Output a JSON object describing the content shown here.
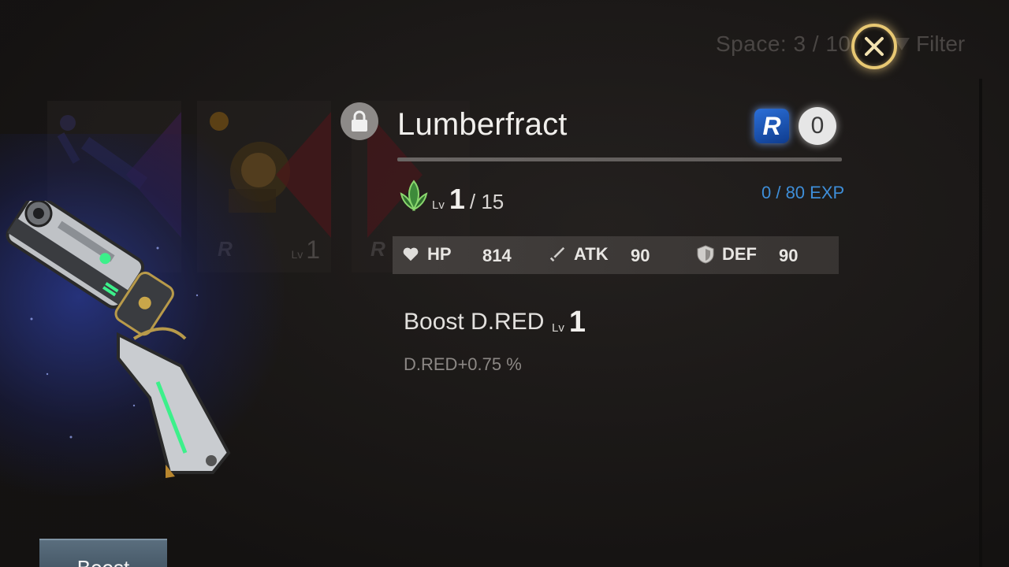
{
  "inventory": {
    "space_label": "Space: 3 / 100",
    "filter_label": "Filter"
  },
  "background_cards": [
    {
      "rarity": "R",
      "lv_prefix": "Lv",
      "level": "1"
    },
    {
      "rarity": "R"
    }
  ],
  "item": {
    "name": "Lumberfract",
    "rarity": "R",
    "refine": "0",
    "lv_prefix": "Lv",
    "level": "1",
    "level_max": "/ 15",
    "exp": "0 / 80 EXP"
  },
  "stats": [
    {
      "label": "HP",
      "value": "814",
      "icon": "heart-icon"
    },
    {
      "label": "ATK",
      "value": "90",
      "icon": "sword-icon"
    },
    {
      "label": "DEF",
      "value": "90",
      "icon": "shield-icon"
    }
  ],
  "skill": {
    "name": "Boost D.RED",
    "lv_prefix": "Lv",
    "level": "1",
    "description": "D.RED+0.75 %"
  },
  "actions": {
    "boost_label": "Boost"
  },
  "colors": {
    "exp_text": "#3e8ed8",
    "rarity_badge": "#2b6fd8",
    "close_ring": "#e8c873"
  }
}
